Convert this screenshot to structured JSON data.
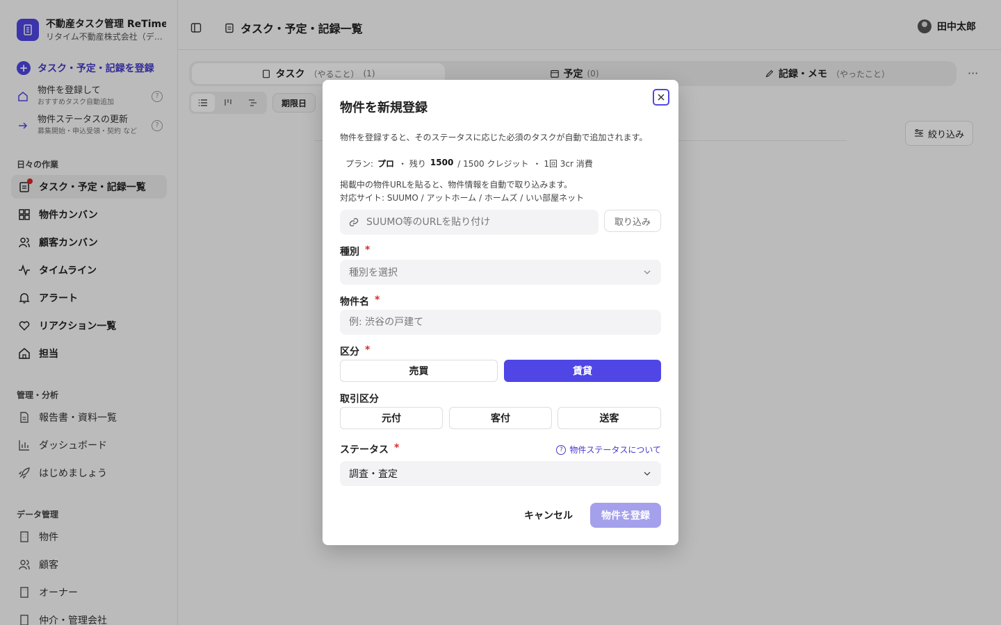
{
  "app": {
    "title": "不動産タスク管理 ReTime",
    "company": "リタイム不動産株式会社（デモ）"
  },
  "sidebar": {
    "primary_action": "タスク・予定・記録を登録",
    "quick": [
      {
        "label": "物件を登録して",
        "sub": "おすすめタスク自動追加",
        "help": "?"
      },
      {
        "label": "物件ステータスの更新",
        "sub": "募集開始・申込受領・契約 など",
        "help": "?"
      }
    ],
    "section_daily": "日々の作業",
    "daily_items": [
      {
        "label": "タスク・予定・記録一覧",
        "icon": "clipboard-icon"
      },
      {
        "label": "物件カンバン",
        "icon": "grid-icon"
      },
      {
        "label": "顧客カンバン",
        "icon": "users-icon"
      },
      {
        "label": "タイムライン",
        "icon": "activity-icon"
      },
      {
        "label": "アラート",
        "icon": "bell-icon"
      },
      {
        "label": "リアクション一覧",
        "icon": "heart-icon"
      },
      {
        "label": "担当",
        "icon": "home-icon"
      }
    ],
    "section_manage": "管理・分析",
    "manage_items": [
      {
        "label": "報告書・資料一覧",
        "icon": "document-icon"
      },
      {
        "label": "ダッシュボード",
        "icon": "chart-icon"
      },
      {
        "label": "はじめましょう",
        "icon": "rocket-icon"
      }
    ],
    "section_data": "データ管理",
    "data_items": [
      {
        "label": "物件",
        "icon": "building-icon"
      },
      {
        "label": "顧客",
        "icon": "users-icon"
      },
      {
        "label": "オーナー",
        "icon": "building-icon"
      },
      {
        "label": "仲介・管理会社",
        "icon": "building-icon"
      }
    ]
  },
  "header": {
    "title": "タスク・予定・記録一覧",
    "user": "田中太郎"
  },
  "tabs": [
    {
      "label": "タスク",
      "sub": "（やること）",
      "count": "(1)"
    },
    {
      "label": "予定",
      "sub": "",
      "count": "(0)"
    },
    {
      "label": "記録・メモ",
      "sub": "（やったこと）",
      "count": ""
    }
  ],
  "toolbar": {
    "chip": "期限日",
    "filter": "絞り込み",
    "more": "···"
  },
  "modal": {
    "title": "物件を新規登録",
    "description": "物件を登録すると、そのステータスに応じた必須のタスクが自動で追加されます。",
    "plan": {
      "prefix": "プラン:",
      "plan_name": "プロ",
      "remaining_label": "・ 残り",
      "remaining": "1500",
      "total": "/ 1500 クレジット",
      "cost": "・ 1回 3cr 消費"
    },
    "hint_line1": "掲載中の物件URLを貼ると、物件情報を自動で取り込みます。",
    "hint_line2": "対応サイト: SUUMO / アットホーム / ホームズ / いい部屋ネット",
    "url_placeholder": "SUUMO等のURLを貼り付け",
    "import_button": "取り込み",
    "type_label": "種別",
    "type_placeholder": "種別を選択",
    "name_label": "物件名",
    "name_placeholder": "例: 渋谷の戸建て",
    "category_label": "区分",
    "category_options": [
      "売買",
      "賃貸"
    ],
    "category_selected": "賃貸",
    "deal_label": "取引区分",
    "deal_options": [
      "元付",
      "客付",
      "送客"
    ],
    "status_label": "ステータス",
    "status_help": "物件ステータスについて",
    "status_value": "調査・査定",
    "required_mark": "*",
    "cancel_button": "キャンセル",
    "submit_button": "物件を登録"
  },
  "colors": {
    "accent": "#4f46e5",
    "required": "#dc2626",
    "submit_disabled": "#a5a0ec"
  }
}
